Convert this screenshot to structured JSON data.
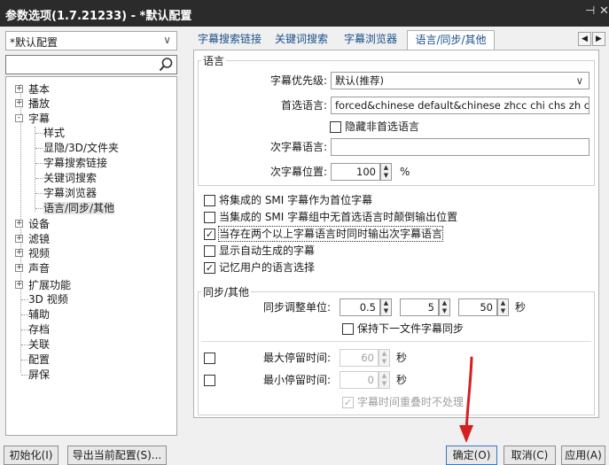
{
  "window": {
    "title": "参数选项(1.7.21233) - *默认配置",
    "pin_glyph": "⊣",
    "close_glyph": "✕"
  },
  "sidebar": {
    "profile": {
      "value": "*默认配置",
      "arrow": "∨"
    },
    "search": {
      "value": ""
    },
    "tree": [
      {
        "label": "基本",
        "expander": "+"
      },
      {
        "label": "播放",
        "expander": "+"
      },
      {
        "label": "字幕",
        "expander": "-"
      },
      {
        "label": "样式"
      },
      {
        "label": "显隐/3D/文件夹"
      },
      {
        "label": "字幕搜索链接"
      },
      {
        "label": "关键词搜索"
      },
      {
        "label": "字幕浏览器"
      },
      {
        "label": "语言/同步/其他",
        "selected": true
      },
      {
        "label": "设备",
        "expander": "+"
      },
      {
        "label": "滤镜",
        "expander": "+"
      },
      {
        "label": "视频",
        "expander": "+"
      },
      {
        "label": "声音",
        "expander": "+"
      },
      {
        "label": "扩展功能",
        "expander": "+"
      },
      {
        "label": "3D 视频"
      },
      {
        "label": "辅助"
      },
      {
        "label": "存档"
      },
      {
        "label": "关联"
      },
      {
        "label": "配置"
      },
      {
        "label": "屏保"
      }
    ]
  },
  "tabs": [
    {
      "label": "字幕搜索链接",
      "active": false
    },
    {
      "label": "关键词搜索",
      "active": false
    },
    {
      "label": "字幕浏览器",
      "active": false
    },
    {
      "label": "语言/同步/其他",
      "active": true
    }
  ],
  "tab_scroll": {
    "left": "◀",
    "right": "▶"
  },
  "language": {
    "group_title": "语言",
    "priority_label": "字幕优先级:",
    "priority_value": "默认(推荐)",
    "dropdown_arrow": "∨",
    "preferred_label": "首选语言:",
    "preferred_value": "forced&chinese default&chinese zhcc chi chs zh chinese",
    "hide_nonpreferred_label": "隐藏非首选语言",
    "hide_nonpreferred_checked": false,
    "secondary_label": "次字幕语言:",
    "secondary_value": "",
    "secondary_pos_label": "次字幕位置:",
    "secondary_pos_value": "100",
    "secondary_pos_unit": "%"
  },
  "options": [
    {
      "label": "将集成的 SMI 字幕作为首位字幕",
      "checked": false
    },
    {
      "label": "当集成的 SMI 字幕组中无首选语言时颠倒输出位置",
      "checked": false
    },
    {
      "label": "当存在两个以上字幕语言时同时输出次字幕语言",
      "checked": true,
      "focused": true
    },
    {
      "label": "显示自动生成的字幕",
      "checked": false
    },
    {
      "label": "记忆用户的语言选择",
      "checked": true
    }
  ],
  "check_mark": "✓",
  "sync": {
    "group_title": "同步/其他",
    "adjust_label": "同步调整单位:",
    "adjust_values": [
      "0.5",
      "5",
      "50"
    ],
    "adjust_unit": "秒",
    "keep_sync_label": "保持下一文件字幕同步",
    "keep_sync_checked": false,
    "max_stay_label": "最大停留时间:",
    "max_stay_value": "60",
    "max_stay_checked": false,
    "min_stay_label": "最小停留时间:",
    "min_stay_value": "0",
    "min_stay_checked": false,
    "stay_unit": "秒",
    "overlap_label": "字幕时间重叠时不处理",
    "overlap_checked": true
  },
  "spin_up": "▲",
  "spin_down": "▼",
  "buttons": {
    "init": "初始化(I)",
    "export": "导出当前配置(S)...",
    "ok": "确定(O)",
    "cancel": "取消(C)",
    "apply": "应用(A)"
  },
  "colors": {
    "accent": "#3a76c4",
    "tab_text": "#1a4f8a",
    "annotation_arrow": "#d42020",
    "titlebar": "#2b2b2b"
  }
}
